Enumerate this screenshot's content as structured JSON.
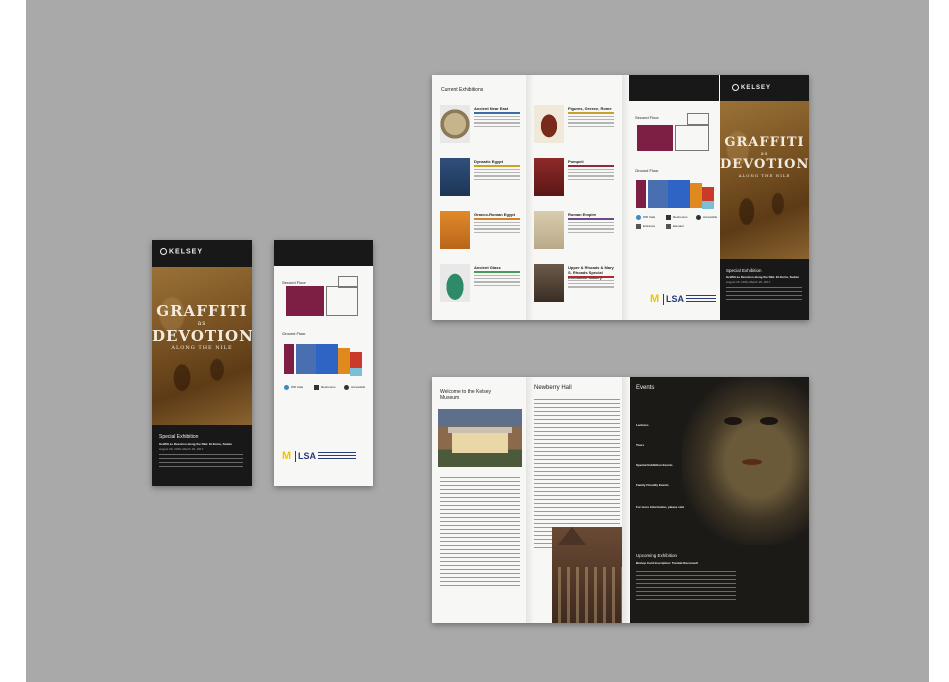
{
  "museum": {
    "logo_text": "KELSEY"
  },
  "exhibition": {
    "title_line1": "GRAFFITI",
    "title_connector": "as",
    "title_line2": "DEVOTION",
    "title_line3": "ALONG THE NILE",
    "label": "Special Exhibition",
    "subtitle": "Graffiti as Devotion along the Nile: El-Kurru, Sudan",
    "dates": "August 26, 2016–March 26, 2017"
  },
  "map": {
    "second_floor": "Second Floor",
    "ground_floor": "Ground Floor",
    "legend_wifi": "Wifi Cafe",
    "legend_restrooms": "Restrooms",
    "legend_accessible": "Accessible",
    "legend_entrance": "Entrance",
    "legend_elevator": "Elevator"
  },
  "current_exhibitions": {
    "heading": "Current Exhibitions",
    "items": [
      {
        "title": "Ancient Near East",
        "color": "#3a6ea5"
      },
      {
        "title": "Dynastic Egypt",
        "color": "#c9a227"
      },
      {
        "title": "Graeco-Roman Egypt",
        "color": "#d9822b"
      },
      {
        "title": "Ancient Glass",
        "color": "#4a9a5a"
      },
      {
        "title": "Figures, Greece, Rome",
        "color": "#c9a227"
      },
      {
        "title": "Pompeii",
        "color": "#8e2a3a"
      },
      {
        "title": "Roman Empire",
        "color": "#6b4a8a"
      },
      {
        "title": "Upper & Rhoads & Mary S. Rhoads Special Exhibition Gallery",
        "color": "#b3272d"
      }
    ]
  },
  "welcome": {
    "heading": "Welcome to the Kelsey Museum"
  },
  "newberry": {
    "heading": "Newberry Hall"
  },
  "events": {
    "heading": "Events",
    "items": [
      "Lectures",
      "Tours",
      "Special Exhibition Events",
      "Family Friendly Events",
      "For more information, please visit"
    ]
  },
  "upcoming": {
    "label": "Upcoming Exhibition",
    "title": "Bishop Card Inscription: Tondah Reconsult"
  },
  "university": {
    "um": "M",
    "lsa": "LSA"
  }
}
